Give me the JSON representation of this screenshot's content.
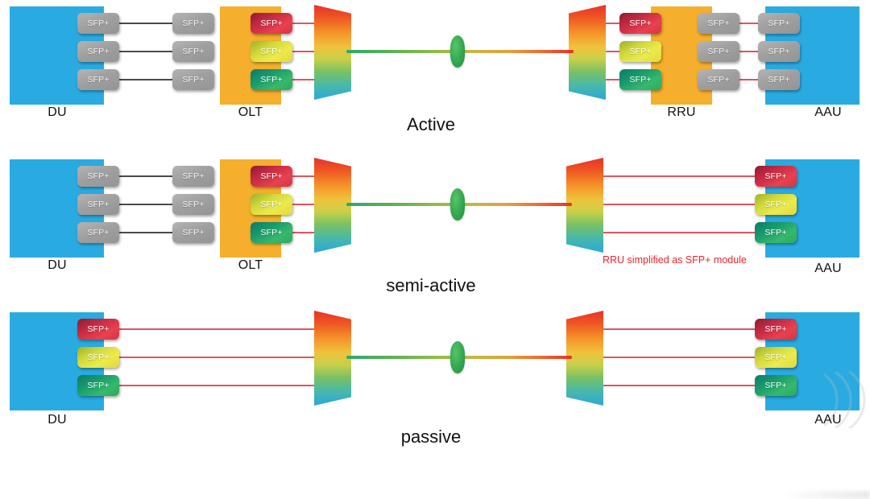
{
  "diagram": {
    "title_text_present": false,
    "sfp_label": "SFP+",
    "colors": {
      "chassis_blue": "#29ABE2",
      "chassis_orange": "#F5AF2D",
      "sfp_gray": "#A6A6A6",
      "sfp_red": "#D8344A",
      "sfp_yellow": "#E4E048",
      "sfp_green": "#27A96A",
      "wire_gray": "#4A4A4A",
      "wire_red": "#E0555E",
      "annotation_red": "#F0232E",
      "spool_green": "#35A94F"
    },
    "rows": [
      {
        "id": "active",
        "caption": "Active",
        "units": [
          {
            "name": "DU",
            "label": "DU",
            "type": "blue"
          },
          {
            "name": "OLT",
            "label": "OLT",
            "type": "orange"
          },
          {
            "name": "RRU",
            "label": "RRU",
            "type": "orange"
          },
          {
            "name": "AAU",
            "label": "AAU",
            "type": "blue"
          }
        ],
        "modules": {
          "du_ports": [
            "SFP+",
            "SFP+",
            "SFP+"
          ],
          "olt_gray": [
            "SFP+",
            "SFP+",
            "SFP+"
          ],
          "olt_colored": [
            "SFP+",
            "SFP+",
            "SFP+"
          ],
          "rru_colored": [
            "SFP+",
            "SFP+",
            "SFP+"
          ],
          "rru_gray": [
            "SFP+",
            "SFP+",
            "SFP+"
          ],
          "aau_ports": [
            "SFP+",
            "SFP+",
            "SFP+"
          ]
        },
        "wavelengths": [
          "red",
          "yellow",
          "green"
        ],
        "annotation": null
      },
      {
        "id": "semi-active",
        "caption": "semi-active",
        "units": [
          {
            "name": "DU",
            "label": "DU",
            "type": "blue"
          },
          {
            "name": "OLT",
            "label": "OLT",
            "type": "orange"
          },
          {
            "name": "AAU",
            "label": "AAU",
            "type": "blue"
          }
        ],
        "modules": {
          "du_ports": [
            "SFP+",
            "SFP+",
            "SFP+"
          ],
          "olt_gray": [
            "SFP+",
            "SFP+",
            "SFP+"
          ],
          "olt_colored": [
            "SFP+",
            "SFP+",
            "SFP+"
          ],
          "aau_colored": [
            "SFP+",
            "SFP+",
            "SFP+"
          ]
        },
        "wavelengths": [
          "red",
          "yellow",
          "green"
        ],
        "annotation": "RRU simplified as SFP+ module"
      },
      {
        "id": "passive",
        "caption": "passive",
        "units": [
          {
            "name": "DU",
            "label": "DU",
            "type": "blue"
          },
          {
            "name": "AAU",
            "label": "AAU",
            "type": "blue"
          }
        ],
        "modules": {
          "du_colored": [
            "SFP+",
            "SFP+",
            "SFP+"
          ],
          "aau_colored": [
            "SFP+",
            "SFP+",
            "SFP+"
          ]
        },
        "wavelengths": [
          "red",
          "yellow",
          "green"
        ],
        "annotation": null
      }
    ],
    "mux_note": "WDM multiplexer prism, gradient red-to-blue",
    "fiber_note": "single trunk fiber with fiber spool"
  }
}
